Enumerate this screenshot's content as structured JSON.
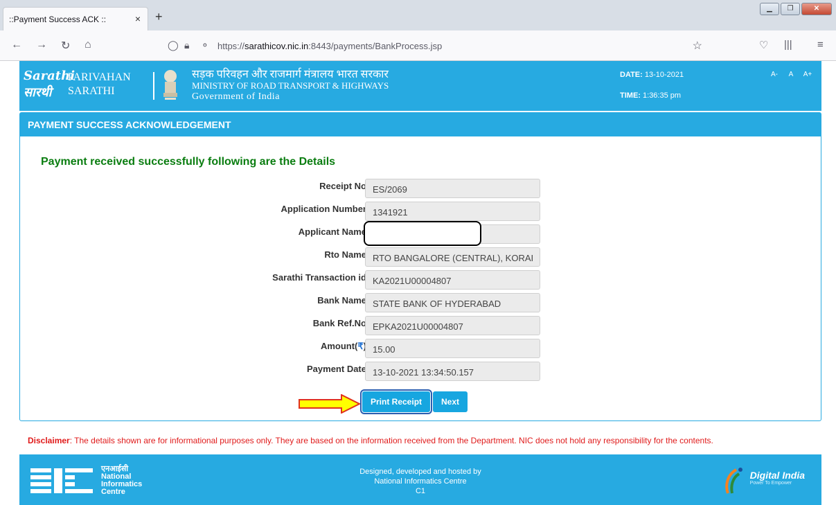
{
  "browser": {
    "tab_title": "::Payment Success ACK ::",
    "tab_close": "×",
    "new_tab": "+",
    "url_prefix": "https://",
    "url_host": "sarathicov.nic.in",
    "url_rest": ":8443/payments/BankProcess.jsp"
  },
  "header": {
    "logo_text_1": "Sarathi",
    "logo_text_2": "सारथी",
    "brand_line1": "PARIVAHAN",
    "brand_line2": "SARATHI",
    "ministry_hindi": "सड़क परिवहन और राजमार्ग मंत्रालय भारत सरकार",
    "ministry_english": "MINISTRY OF ROAD TRANSPORT & HIGHWAYS",
    "government": "Government of India",
    "date_label": "DATE:",
    "date_value": "13-10-2021",
    "time_label": "TIME:",
    "time_value": "1:36:35 pm",
    "font_decrease": "A-",
    "font_normal": "A",
    "font_increase": "A+"
  },
  "panel": {
    "heading": "PAYMENT SUCCESS ACKNOWLEDGEMENT",
    "success_message": "Payment received successfully following are the Details",
    "fields": [
      {
        "label": "Receipt No",
        "value": "ES/2069"
      },
      {
        "label": "Application Number",
        "value": "1341921"
      },
      {
        "label": "Applicant Name",
        "value": ""
      },
      {
        "label": "Rto Name",
        "value": "RTO BANGALORE (CENTRAL), KORAI"
      },
      {
        "label": "Sarathi Transaction id",
        "value": "KA2021U00004807"
      },
      {
        "label": "Bank Name",
        "value": "STATE BANK OF HYDERABAD"
      },
      {
        "label": "Bank Ref.No",
        "value": "EPKA2021U00004807"
      },
      {
        "label": "Amount(",
        "value": "15.00"
      },
      {
        "label": "Payment Date",
        "value": "13-10-2021 13:34:50.157"
      }
    ],
    "amount_currency": "₹",
    "amount_suffix": ")",
    "print_receipt": "Print Receipt",
    "next": "Next"
  },
  "disclaimer": {
    "label": "Disclaimer",
    "text": ": The details shown are for informational purposes only. They are based on the information received from the Department. NIC does not hold any responsibility for the contents."
  },
  "footer": {
    "nic_hindi": "एनआईसी",
    "nic_line1": "National",
    "nic_line2": "Informatics",
    "nic_line3": "Centre",
    "designed_by": "Designed, developed and hosted by",
    "designer": "National Informatics Centre",
    "code": "C1",
    "di_title": "Digital India",
    "di_tagline": "Power To Empower"
  }
}
